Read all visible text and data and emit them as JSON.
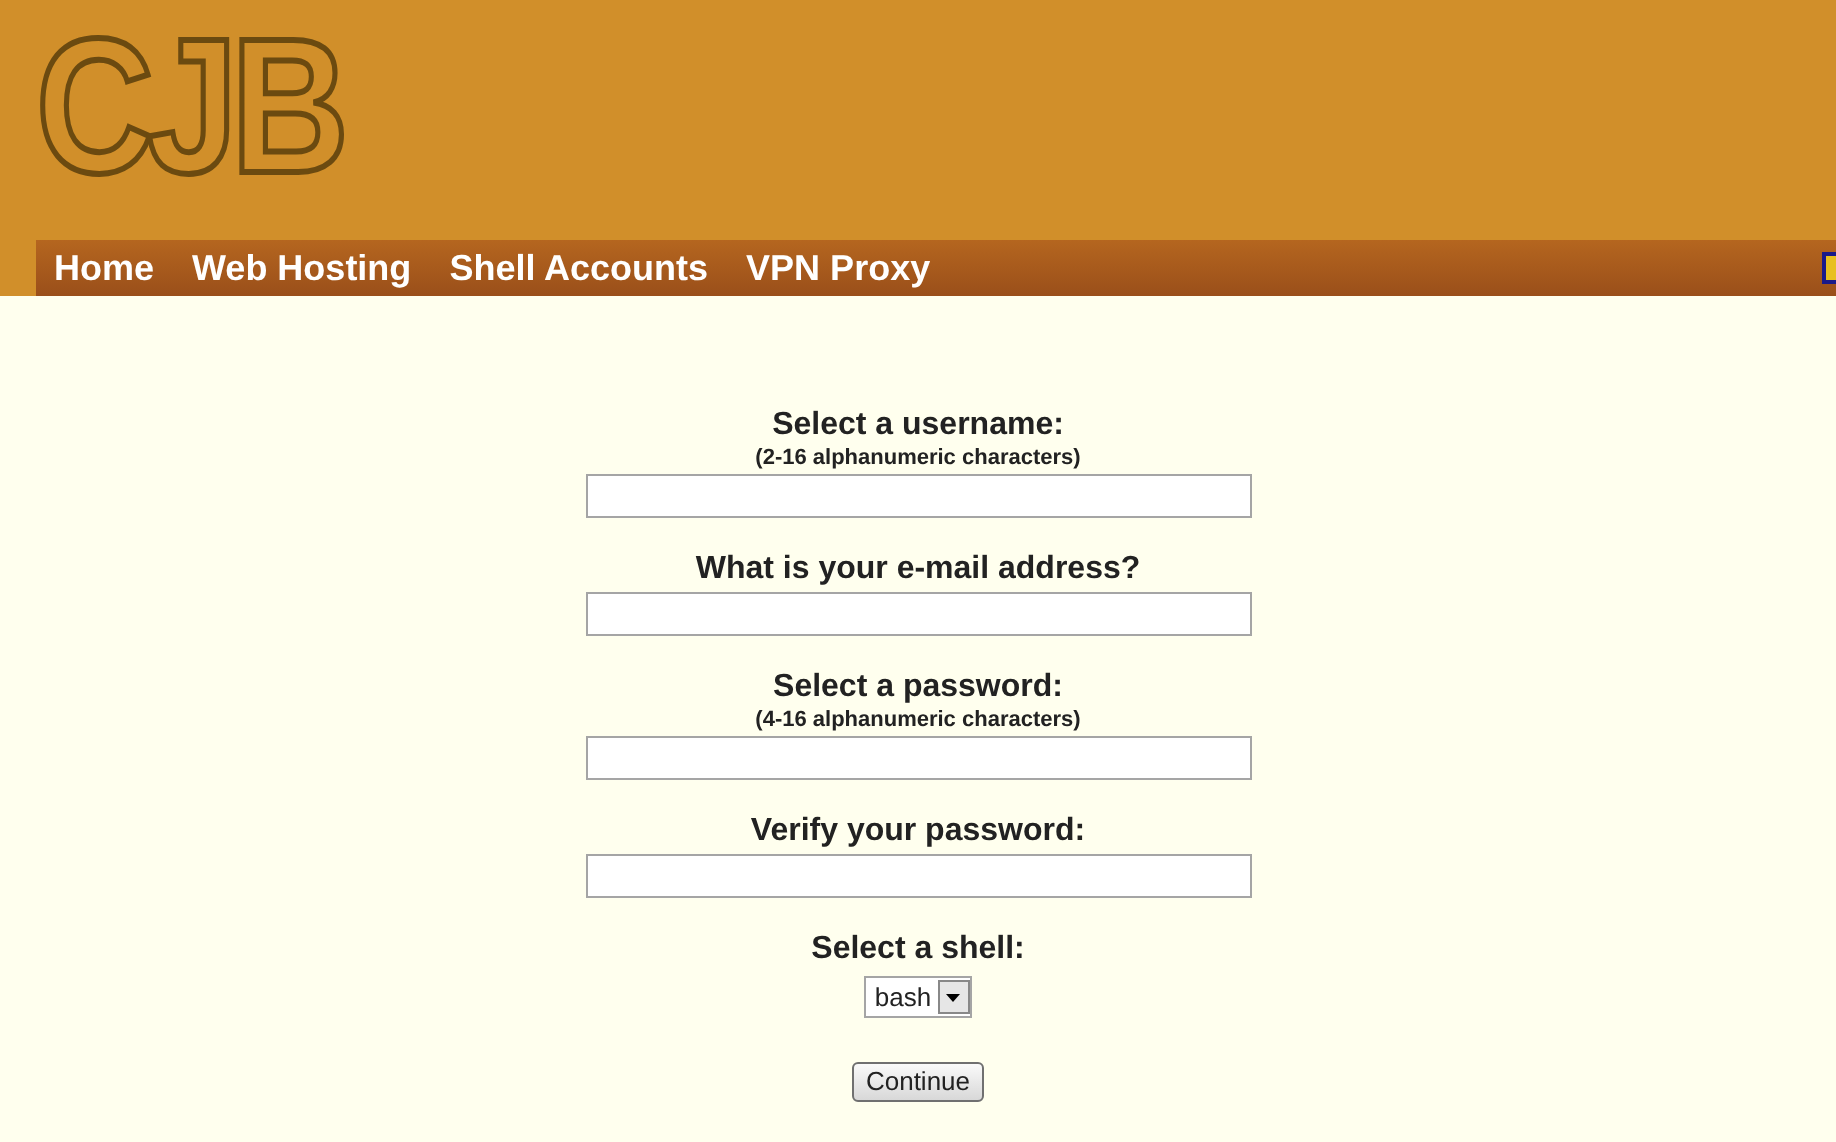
{
  "logo": "CJB",
  "nav": [
    "Home",
    "Web Hosting",
    "Shell Accounts",
    "VPN Proxy"
  ],
  "form": {
    "fields": [
      {
        "kind": "text",
        "label": "Select a username:",
        "hint": "(2-16 alphanumeric characters)"
      },
      {
        "kind": "text",
        "label": "What is your e-mail address?"
      },
      {
        "kind": "password",
        "label": "Select a password:",
        "hint": "(4-16 alphanumeric characters)"
      },
      {
        "kind": "password",
        "label": "Verify your password:"
      },
      {
        "kind": "select",
        "label": "Select a shell:",
        "value": "bash"
      }
    ],
    "submit": "Continue"
  }
}
